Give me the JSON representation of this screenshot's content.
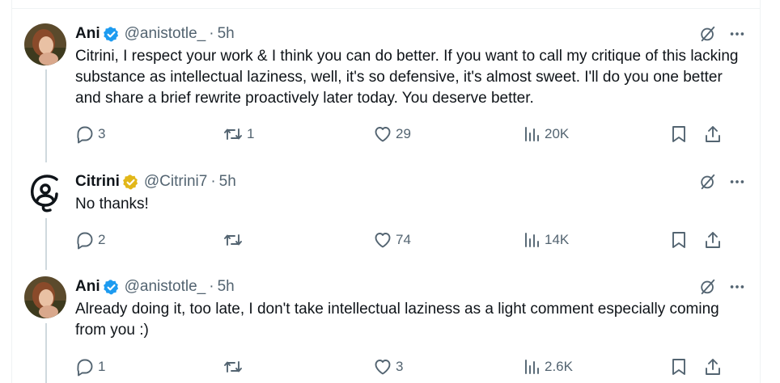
{
  "tweets": [
    {
      "name": "Ani",
      "badge": "blue",
      "handle": "@anistotle_",
      "separator": "·",
      "time": "5h",
      "text": "Citrini, I respect your work & I think you can do better. If you want to call my critique of this lacking substance as intellectual laziness, well, it's so defensive, it's almost sweet. I'll do you one better and share a brief rewrite proactively later today. You deserve better.",
      "replies": "3",
      "reposts": "1",
      "likes": "29",
      "views": "20K"
    },
    {
      "name": "Citrini",
      "badge": "gold",
      "handle": "@Citrini7",
      "separator": "·",
      "time": "5h",
      "text": "No thanks!",
      "replies": "2",
      "reposts": "",
      "likes": "74",
      "views": "14K"
    },
    {
      "name": "Ani",
      "badge": "blue",
      "handle": "@anistotle_",
      "separator": "·",
      "time": "5h",
      "text": "Already doing it, too late, I don't take intellectual laziness as a light comment especially coming from you :)",
      "replies": "1",
      "reposts": "",
      "likes": "3",
      "views": "2.6K"
    }
  ],
  "icons": {
    "reply": "reply-icon",
    "repost": "repost-icon",
    "like": "heart-icon",
    "views": "views-icon",
    "bookmark": "bookmark-icon",
    "share": "share-icon",
    "grok": "grok-icon",
    "more": "more-icon"
  },
  "colors": {
    "verified_blue": "#1d9bf0",
    "verified_gold": "#e2b719",
    "secondary_text": "#536471",
    "primary_text": "#0f1419",
    "thread_line": "#cfd9de"
  }
}
